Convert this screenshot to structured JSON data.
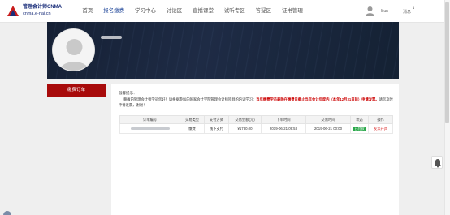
{
  "brand": {
    "name": "管理会计师CNMA",
    "domain": "cnma.e-nai.cn"
  },
  "nav": {
    "items": [
      {
        "label": "首页",
        "active": false
      },
      {
        "label": "报名缴费",
        "active": true
      },
      {
        "label": "学习中心",
        "active": false
      },
      {
        "label": "讨论区",
        "active": false
      },
      {
        "label": "直播课堂",
        "active": false
      },
      {
        "label": "试听专区",
        "active": false
      },
      {
        "label": "答疑区",
        "active": false
      },
      {
        "label": "证书管理",
        "active": false
      }
    ]
  },
  "header": {
    "user_label": "lijun",
    "messages_label": "消息",
    "messages_count": "1"
  },
  "sidebar": {
    "paid_orders_label": "缴费订单"
  },
  "notice": {
    "title": "温馨提示：",
    "body_prefix": "尊敬的管理会计师学员您好！请根据参加的国家会计学院管理会计师项目的培训学习：",
    "body_highlight": "当年缴费学员最晚在缴费日截止当年会计年度内（本年12月31日前）申请发票。",
    "body_suffix": "请您及时申请发票，谢谢！"
  },
  "orders_table": {
    "columns": [
      "订单编号",
      "交易类型",
      "支付方式",
      "交易金额(元)",
      "下单时间",
      "交易时间",
      "状态",
      "操作"
    ],
    "rows": [
      {
        "order_no": "",
        "type": "缴费",
        "pay_method": "线下支付",
        "amount": "¥1780.00",
        "order_time": "2019-06-21 09:53",
        "trade_time": "2019-06-21 00:00",
        "status": "已付款",
        "action": "发票开具"
      }
    ]
  },
  "colors": {
    "primary_blue": "#2a4f9e",
    "sidebar_red": "#a80b0b",
    "status_green": "#2aa84a",
    "banner_navy": "#1e2b45"
  }
}
